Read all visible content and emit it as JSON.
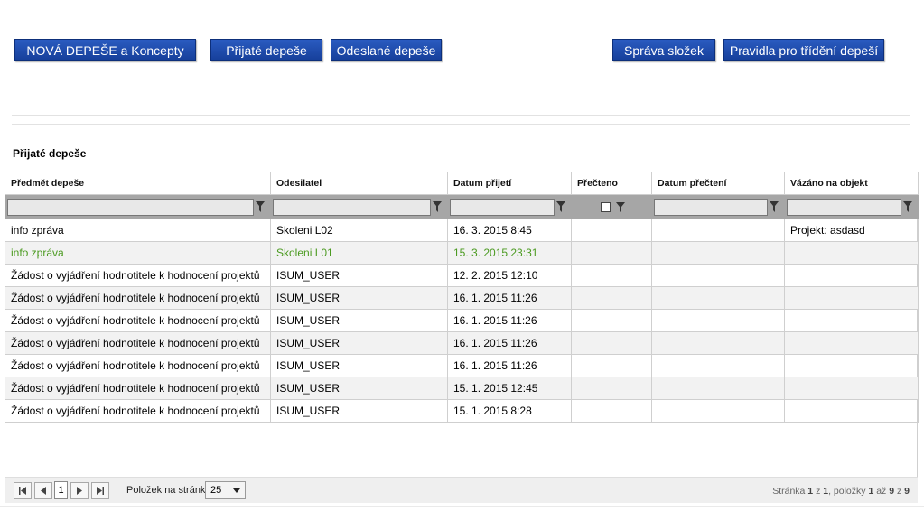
{
  "toolbar": {
    "new_label": "NOVÁ DEPEŠE a Koncepty",
    "received_label": "Přijaté depeše",
    "sent_label": "Odeslané depeše",
    "folders_label": "Správa složek",
    "rules_label": "Pravidla pro třídění depeší"
  },
  "section": {
    "title": "Přijaté depeše"
  },
  "columns": [
    "Předmět depeše",
    "Odesilatel",
    "Datum přijetí",
    "Přečteno",
    "Datum přečtení",
    "Vázáno na objekt"
  ],
  "rows": [
    [
      "info zpráva",
      "Skoleni L02",
      "16. 3. 2015 8:45",
      "",
      "",
      "Projekt: asdasd"
    ],
    [
      "info zpráva",
      "Skoleni L01",
      "15. 3. 2015 23:31",
      "",
      "",
      ""
    ],
    [
      "Žádost o vyjádření hodnotitele k hodnocení projektů",
      "ISUM_USER",
      "12. 2. 2015 12:10",
      "",
      "",
      ""
    ],
    [
      "Žádost o vyjádření hodnotitele k hodnocení projektů",
      "ISUM_USER",
      "16. 1. 2015 11:26",
      "",
      "",
      ""
    ],
    [
      "Žádost o vyjádření hodnotitele k hodnocení projektů",
      "ISUM_USER",
      "16. 1. 2015 11:26",
      "",
      "",
      ""
    ],
    [
      "Žádost o vyjádření hodnotitele k hodnocení projektů",
      "ISUM_USER",
      "16. 1. 2015 11:26",
      "",
      "",
      ""
    ],
    [
      "Žádost o vyjádření hodnotitele k hodnocení projektů",
      "ISUM_USER",
      "16. 1. 2015 11:26",
      "",
      "",
      ""
    ],
    [
      "Žádost o vyjádření hodnotitele k hodnocení projektů",
      "ISUM_USER",
      "15. 1. 2015 12:45",
      "",
      "",
      ""
    ],
    [
      "Žádost o vyjádření hodnotitele k hodnocení projektů",
      "ISUM_USER",
      "15. 1. 2015 8:28",
      "",
      "",
      ""
    ]
  ],
  "highlight_color": "#4a9a1f",
  "pager": {
    "page": "1",
    "per_page_label": "Položek na stránku",
    "per_page_value": "25",
    "info_prefix": "Stránka",
    "info_page": "1",
    "info_of": "z",
    "info_pages": "1",
    "info_items_label": ", položky",
    "info_from": "1",
    "info_to_word": "až",
    "info_to": "9",
    "info_total_word": "z",
    "info_total": "9"
  }
}
